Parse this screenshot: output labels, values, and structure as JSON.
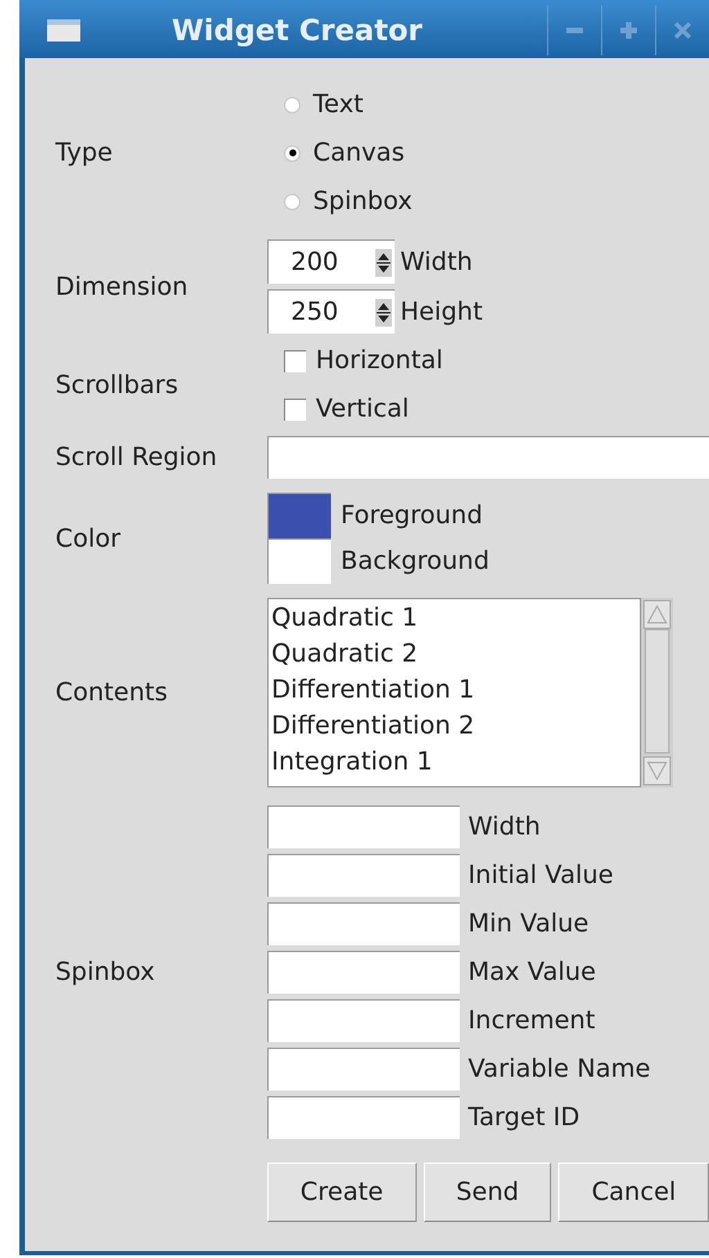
{
  "window": {
    "title": "Widget Creator"
  },
  "type": {
    "label": "Type",
    "options": [
      {
        "label": "Text",
        "selected": false
      },
      {
        "label": "Canvas",
        "selected": true
      },
      {
        "label": "Spinbox",
        "selected": false
      }
    ]
  },
  "dimension": {
    "label": "Dimension",
    "fields": [
      {
        "value": "200",
        "label": "Width"
      },
      {
        "value": "250",
        "label": "Height"
      }
    ]
  },
  "scrollbars": {
    "label": "Scrollbars",
    "options": [
      {
        "label": "Horizontal",
        "checked": false
      },
      {
        "label": "Vertical",
        "checked": false
      }
    ]
  },
  "scroll_region": {
    "label": "Scroll Region"
  },
  "color": {
    "label": "Color",
    "swatches": [
      {
        "label": "Foreground",
        "color": "#3a4fae"
      },
      {
        "label": "Background",
        "color": "#ffffff"
      }
    ]
  },
  "contents": {
    "label": "Contents",
    "items": [
      "Quadratic 1",
      "Quadratic 2",
      "Differentiation 1",
      "Differentiation 2",
      "Integration 1"
    ]
  },
  "spinbox": {
    "label": "Spinbox",
    "fields": [
      {
        "label": "Width"
      },
      {
        "label": "Initial Value"
      },
      {
        "label": "Min Value"
      },
      {
        "label": "Max Value"
      },
      {
        "label": "Increment"
      },
      {
        "label": "Variable Name"
      },
      {
        "label": "Target ID"
      }
    ]
  },
  "buttons": [
    "Create",
    "Send",
    "Cancel"
  ]
}
